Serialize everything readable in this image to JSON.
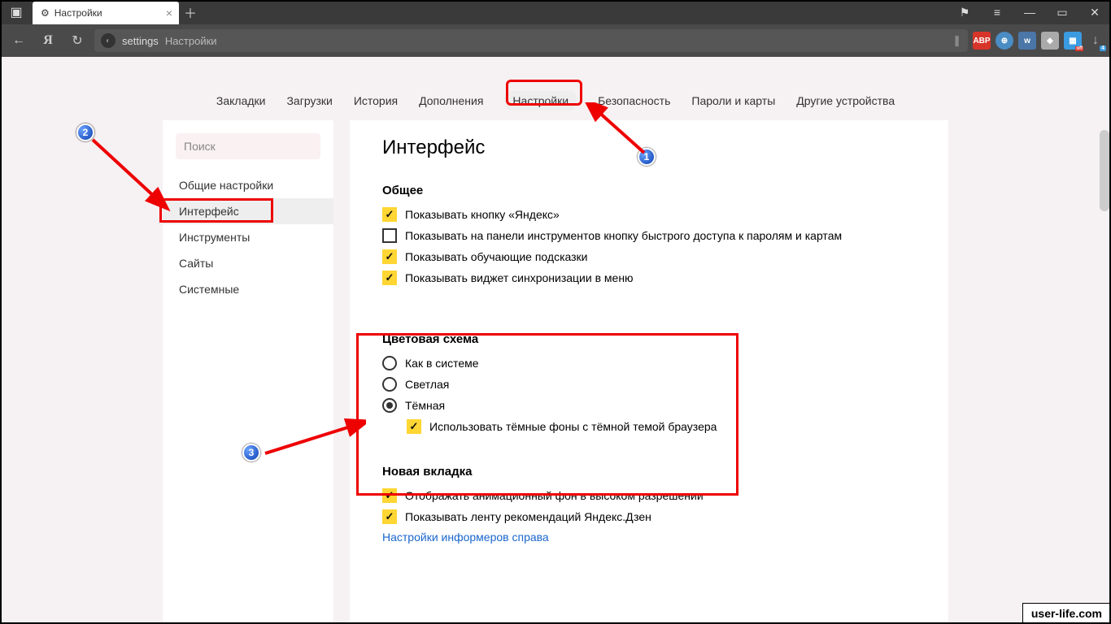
{
  "titlebar": {
    "tab_title": "Настройки"
  },
  "addr": {
    "path1": "settings",
    "path2": "Настройки"
  },
  "topnav": {
    "items": [
      "Закладки",
      "Загрузки",
      "История",
      "Дополнения",
      "Настройки",
      "Безопасность",
      "Пароли и карты",
      "Другие устройства"
    ],
    "active_index": 4
  },
  "sidebar": {
    "search_placeholder": "Поиск",
    "items": [
      "Общие настройки",
      "Интерфейс",
      "Инструменты",
      "Сайты",
      "Системные"
    ],
    "active_index": 1
  },
  "main": {
    "heading": "Интерфейс",
    "section_general": {
      "title": "Общее",
      "opts": [
        {
          "label": "Показывать кнопку «Яндекс»",
          "checked": true
        },
        {
          "label": "Показывать на панели инструментов кнопку быстрого доступа к паролям и картам",
          "checked": false
        },
        {
          "label": "Показывать обучающие подсказки",
          "checked": true
        },
        {
          "label": "Показывать виджет синхронизации в меню",
          "checked": true
        }
      ]
    },
    "section_color": {
      "title": "Цветовая схема",
      "radios": [
        {
          "label": "Как в системе",
          "selected": false
        },
        {
          "label": "Светлая",
          "selected": false
        },
        {
          "label": "Тёмная",
          "selected": true
        }
      ],
      "sub_opt": {
        "label": "Использовать тёмные фоны с тёмной темой браузера",
        "checked": true
      }
    },
    "section_newtab": {
      "title": "Новая вкладка",
      "opts": [
        {
          "label": "Отображать анимационный фон в высоком разрешении",
          "checked": true
        },
        {
          "label": "Показывать ленту рекомендаций Яндекс.Дзен",
          "checked": true
        }
      ],
      "link": "Настройки информеров справа"
    }
  },
  "annotations": {
    "n1": "1",
    "n2": "2",
    "n3": "3"
  },
  "watermark": "user-life.com"
}
